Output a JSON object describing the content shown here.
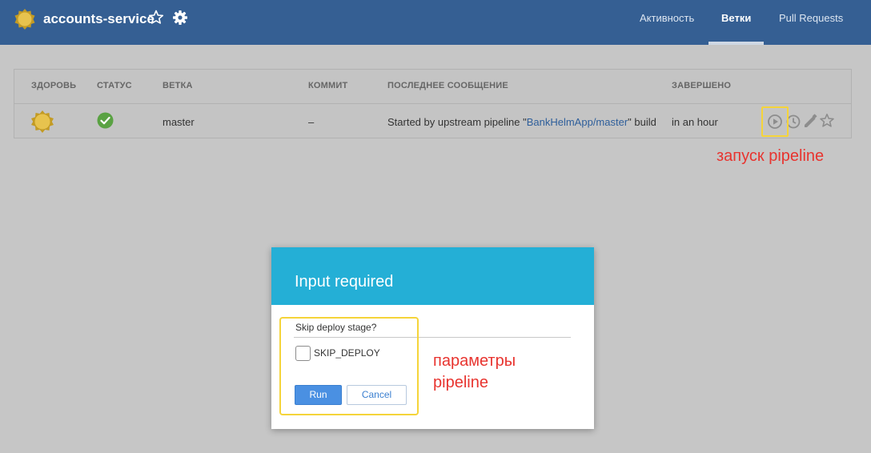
{
  "header": {
    "title": "accounts-service",
    "tabs": [
      {
        "label": "Активность",
        "active": false
      },
      {
        "label": "Ветки",
        "active": true
      },
      {
        "label": "Pull Requests",
        "active": false
      }
    ],
    "icons": [
      "logo-icon",
      "favorite-star-icon",
      "gear-icon"
    ],
    "colors": {
      "background": "#355f93"
    }
  },
  "branches_table": {
    "columns": [
      "ЗДОРОВЬ",
      "СТАТУС",
      "ВЕТКА",
      "КОММИТ",
      "ПОСЛЕДНЕЕ СООБЩЕНИЕ",
      "ЗАВЕРШЕНО"
    ],
    "rows": [
      {
        "health": "sunny-weather-icon",
        "status": "success-check-icon",
        "branch": "master",
        "commit": "–",
        "message_prefix": "Started by upstream pipeline \"",
        "message_link": "BankHelmApp/master",
        "message_suffix": "\" build",
        "completed": "in an hour",
        "actions": [
          "run-play-icon",
          "history-clock-icon",
          "edit-pencil-icon",
          "favorite-star-icon"
        ]
      }
    ]
  },
  "annotations": {
    "run_pipeline": "запуск pipeline",
    "pipeline_params": "параметры pipeline",
    "highlight_color": "#f5d43a",
    "text_color": "#e8342f"
  },
  "dialog": {
    "title": "Input required",
    "parameter_label": "Skip deploy stage?",
    "checkbox_label": "SKIP_DEPLOY",
    "checkbox_checked": false,
    "run_label": "Run",
    "cancel_label": "Cancel",
    "colors": {
      "header": "#24afd6",
      "primary": "#4a90e2"
    }
  }
}
